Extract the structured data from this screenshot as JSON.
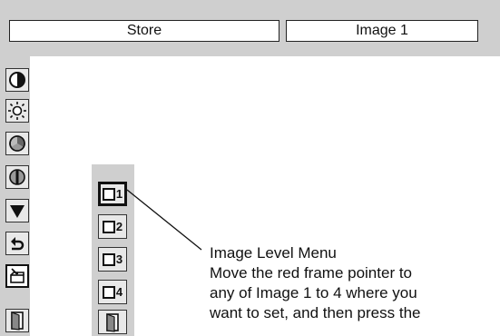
{
  "header": {
    "store_label": "Store",
    "image_field_value": "Image 1"
  },
  "side_tools": [
    {
      "icon": "contrast-icon"
    },
    {
      "icon": "brightness-icon"
    },
    {
      "icon": "color-icon"
    },
    {
      "icon": "tint-icon"
    },
    {
      "icon": "sharpness-icon"
    },
    {
      "icon": "reset-icon"
    },
    {
      "icon": "store-icon"
    },
    {
      "icon": "quit-icon"
    }
  ],
  "image_levels": [
    {
      "label": "1"
    },
    {
      "label": "2"
    },
    {
      "label": "3"
    },
    {
      "label": "4"
    },
    {
      "icon": "quit-icon"
    }
  ],
  "selected_level": "1",
  "callout": {
    "title": "Image Level Menu",
    "lines": [
      "Move the red frame pointer to",
      "any of Image 1 to 4 where you",
      "want to set, and then press the"
    ]
  }
}
